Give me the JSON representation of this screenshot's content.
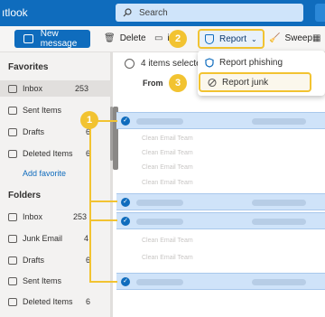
{
  "app": {
    "title": "ıtlook"
  },
  "search": {
    "placeholder": "Search"
  },
  "toolbar": {
    "new_message": "New message",
    "delete": "Delete",
    "archive_partial": "ive",
    "report": "Report",
    "sweep": "Sweep"
  },
  "report_menu": {
    "items": [
      {
        "label": "Report phishing"
      },
      {
        "label": "Report junk"
      }
    ]
  },
  "sidebar": {
    "favorites_header": "Favorites",
    "favorites": [
      {
        "label": "Inbox",
        "count": "253"
      },
      {
        "label": "Sent Items",
        "count": ""
      },
      {
        "label": "Drafts",
        "count": "6"
      },
      {
        "label": "Deleted Items",
        "count": "6"
      }
    ],
    "add_favorite": "Add favorite",
    "folders_header": "Folders",
    "folders": [
      {
        "label": "Inbox",
        "count": "253"
      },
      {
        "label": "Junk Email",
        "count": "4"
      },
      {
        "label": "Drafts",
        "count": "6"
      },
      {
        "label": "Sent Items",
        "count": ""
      },
      {
        "label": "Deleted Items",
        "count": "6"
      }
    ]
  },
  "maillist": {
    "selection_text": "4 items selecte",
    "from_label": "From",
    "rows": [
      {
        "text": "",
        "selected": true
      },
      {
        "text": "Clean Email Team",
        "selected": false
      },
      {
        "text": "Clean Email Team",
        "selected": false
      },
      {
        "text": "Clean Email Team",
        "selected": false
      },
      {
        "text": "Clean Email Team",
        "selected": false
      },
      {
        "text": "",
        "selected": true
      },
      {
        "text": "",
        "selected": true
      },
      {
        "text": "Clean Email Team",
        "selected": false
      },
      {
        "text": "Clean Email Team",
        "selected": false
      },
      {
        "text": "",
        "selected": true
      }
    ]
  },
  "steps": {
    "one": "1",
    "two": "2",
    "three": "3"
  },
  "colors": {
    "accent": "#0f6cbd",
    "highlight": "#f2c331",
    "selected_row": "#cfe3f9"
  }
}
